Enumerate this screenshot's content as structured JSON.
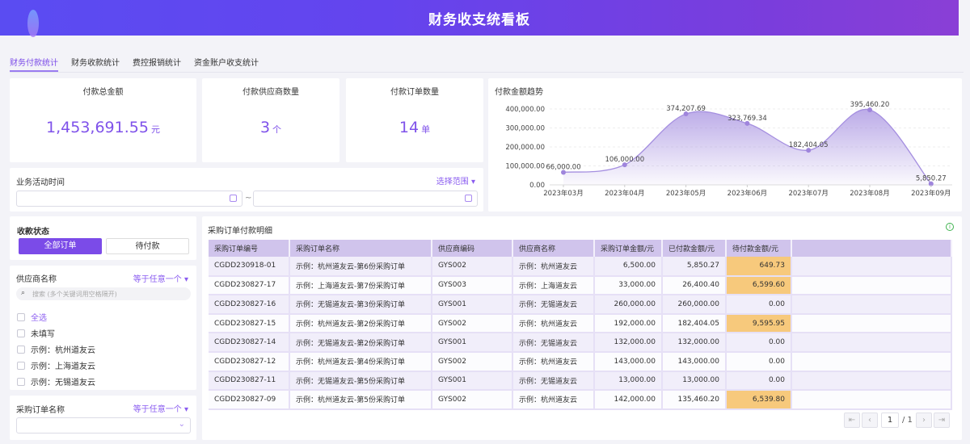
{
  "header": {
    "title": "财务收支统看板"
  },
  "tabs": [
    {
      "label": "财务付款统计",
      "active": true
    },
    {
      "label": "财务收款统计"
    },
    {
      "label": "费控报销统计"
    },
    {
      "label": "资金账户收支统计"
    }
  ],
  "kpis": [
    {
      "label": "付款总金额",
      "value": "1,453,691.55",
      "unit": "元"
    },
    {
      "label": "付款供应商数量",
      "value": "3",
      "unit": "个"
    },
    {
      "label": "付款订单数量",
      "value": "14",
      "unit": "单"
    }
  ],
  "date_filter": {
    "label": "业务活动时间",
    "range_label": "选择范围",
    "separator": "~"
  },
  "status_filter": {
    "label": "收款状态",
    "options": [
      {
        "label": "全部订单",
        "selected": true
      },
      {
        "label": "待付款"
      }
    ]
  },
  "supplier_filter": {
    "label": "供应商名称",
    "mode": "等于任意一个",
    "search_placeholder": "搜索 (多个关键词用空格隔开)",
    "options": [
      "全选",
      "未填写",
      "示例：杭州道友云",
      "示例：上海道友云",
      "示例：无锡道友云"
    ]
  },
  "order_filter": {
    "label": "采购订单名称",
    "mode": "等于任意一个"
  },
  "chart_data": {
    "type": "area",
    "title": "付款金额趋势",
    "categories": [
      "2023年03月",
      "2023年04月",
      "2023年05月",
      "2023年06月",
      "2023年07月",
      "2023年08月",
      "2023年09月"
    ],
    "values": [
      66000.0,
      106000.0,
      374207.69,
      323769.34,
      182404.05,
      395460.2,
      5850.27
    ],
    "value_labels": [
      "66,000.00",
      "106,000.00",
      "374,207.69",
      "323,769.34",
      "182,404.05",
      "395,460.20",
      "5,850.27"
    ],
    "yticks": [
      "0.00",
      "100,000.00",
      "200,000.00",
      "300,000.00",
      "400,000.00"
    ],
    "ylim": [
      0,
      400000
    ],
    "color": "#a58fe0"
  },
  "table": {
    "title": "采购订单付款明细",
    "columns": [
      "采购订单编号",
      "采购订单名称",
      "供应商编码",
      "供应商名称",
      "采购订单金额/元",
      "已付款金额/元",
      "待付款金额/元"
    ],
    "rows": [
      [
        "CGDD230918-01",
        "示例：杭州道友云-第6份采购订单",
        "GYS002",
        "示例：杭州道友云",
        "6,500.00",
        "5,850.27",
        "649.73"
      ],
      [
        "CGDD230827-17",
        "示例：上海道友云-第7份采购订单",
        "GYS003",
        "示例：上海道友云",
        "33,000.00",
        "26,400.40",
        "6,599.60"
      ],
      [
        "CGDD230827-16",
        "示例：无锡道友云-第3份采购订单",
        "GYS001",
        "示例：无锡道友云",
        "260,000.00",
        "260,000.00",
        "0.00"
      ],
      [
        "CGDD230827-15",
        "示例：杭州道友云-第2份采购订单",
        "GYS002",
        "示例：杭州道友云",
        "192,000.00",
        "182,404.05",
        "9,595.95"
      ],
      [
        "CGDD230827-14",
        "示例：无锡道友云-第2份采购订单",
        "GYS001",
        "示例：无锡道友云",
        "132,000.00",
        "132,000.00",
        "0.00"
      ],
      [
        "CGDD230827-12",
        "示例：杭州道友云-第4份采购订单",
        "GYS002",
        "示例：杭州道友云",
        "143,000.00",
        "143,000.00",
        "0.00"
      ],
      [
        "CGDD230827-11",
        "示例：无锡道友云-第5份采购订单",
        "GYS001",
        "示例：无锡道友云",
        "13,000.00",
        "13,000.00",
        "0.00"
      ],
      [
        "CGDD230827-09",
        "示例：杭州道友云-第5份采购订单",
        "GYS002",
        "示例：杭州道友云",
        "142,000.00",
        "135,460.20",
        "6,539.80"
      ]
    ],
    "highlight_color": "#f7c97c"
  },
  "pagination": {
    "current": "1",
    "total": "/ 1"
  }
}
